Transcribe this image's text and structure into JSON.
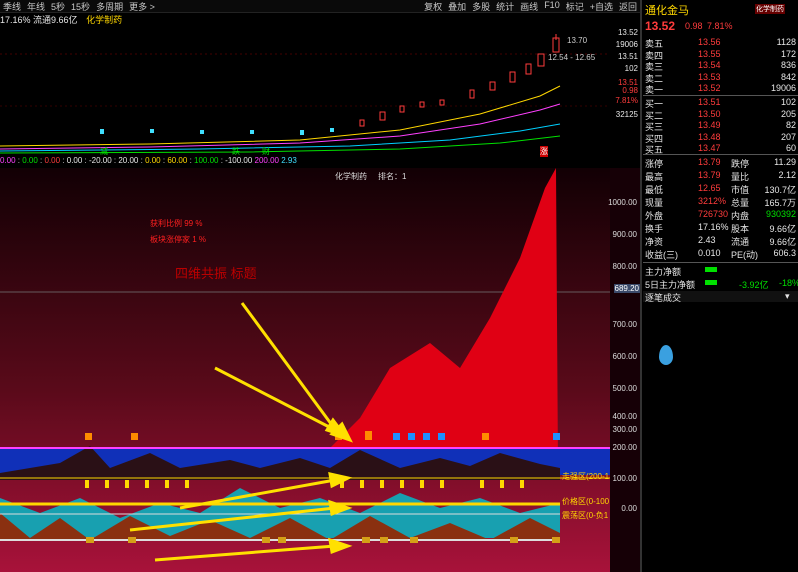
{
  "toolbar": {
    "items": [
      "季线",
      "年线",
      "5秒",
      "15秒",
      "多周期",
      "更多 >"
    ],
    "right_items": [
      "复权",
      "叠加",
      "多股",
      "统计",
      "画线",
      "F10",
      "标记",
      "+自选",
      "返回"
    ]
  },
  "info": {
    "text": "17.16% 流通9.66亿",
    "tag": "化学制药"
  },
  "price_axis": [
    "13.52",
    "19006",
    "13.51",
    "102",
    "13.51",
    "7.81%",
    "32125",
    "0.98"
  ],
  "price_marks": {
    "high": "13.70",
    "range": "12.54 - 12.65"
  },
  "price_labels": {
    "a": "减",
    "b": "跌",
    "c": "财",
    "d": "涨"
  },
  "indicator": [
    "0.00",
    "0.00",
    "0.00",
    "0.00",
    "-20.00",
    "20.00",
    "0.00",
    "60.00",
    "100.00",
    "-100.00",
    "200.00",
    "2.93"
  ],
  "main": {
    "title": "化学制药",
    "rank": "排名：1",
    "annot1": "获利比例 99 %",
    "annot2": "板块涨停家 1 %",
    "annot3": "四维共振  标题",
    "price_tag": "689.20",
    "zone_labels": [
      "走强区(200-1",
      "价格区(0-100",
      "震荡区(0-负1"
    ],
    "axis": [
      "1000.00",
      "900.00",
      "800.00",
      "700.00",
      "600.00",
      "500.00",
      "400.00",
      "300.00",
      "200.00",
      "100.00",
      "0.00"
    ]
  },
  "quote": {
    "name": "通化金马",
    "sub": "化学制药",
    "price": "13.52",
    "change": "0.98",
    "pct": "7.81%",
    "asks": [
      {
        "label": "卖五",
        "price": "13.56",
        "vol": "1128"
      },
      {
        "label": "卖四",
        "price": "13.55",
        "vol": "172"
      },
      {
        "label": "卖三",
        "price": "13.54",
        "vol": "836"
      },
      {
        "label": "卖二",
        "price": "13.53",
        "vol": "842"
      },
      {
        "label": "卖一",
        "price": "13.52",
        "vol": "19006"
      }
    ],
    "bids": [
      {
        "label": "买一",
        "price": "13.51",
        "vol": "102"
      },
      {
        "label": "买二",
        "price": "13.50",
        "vol": "205"
      },
      {
        "label": "买三",
        "price": "13.49",
        "vol": "82"
      },
      {
        "label": "买四",
        "price": "13.48",
        "vol": "207"
      },
      {
        "label": "买五",
        "price": "13.47",
        "vol": "60"
      }
    ],
    "stats": [
      {
        "k1": "涨停",
        "v1": "13.79",
        "k2": "跌停",
        "v2": "11.29"
      },
      {
        "k1": "最高",
        "v1": "13.79",
        "k2": "量比",
        "v2": "2.12"
      },
      {
        "k1": "最低",
        "v1": "12.65",
        "k2": "市值",
        "v2": "130.7亿"
      },
      {
        "k1": "现量",
        "v1": "3212%",
        "k2": "总量",
        "v2": "165.7万"
      },
      {
        "k1": "外盘",
        "v1": "726730",
        "k2": "内盘",
        "v2": "930392"
      },
      {
        "k1": "换手",
        "v1": "17.16%",
        "k2": "股本",
        "v2": "9.66亿"
      },
      {
        "k1": "净资",
        "v1": "2.43",
        "k2": "流通",
        "v2": "9.66亿"
      },
      {
        "k1": "收益(三)",
        "v1": "0.010",
        "k2": "PE(动)",
        "v2": "606.3"
      }
    ],
    "flow1_label": "主力净额",
    "flow2_label": "5日主力净额",
    "flow2_val": "-3.92亿",
    "flow2_pct": "-18%",
    "panel_title": "逐笔成交"
  }
}
